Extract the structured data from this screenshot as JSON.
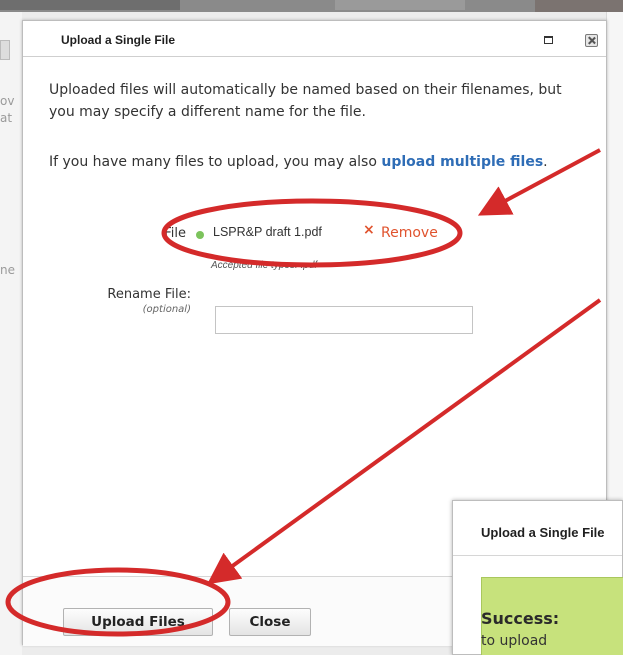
{
  "colors": {
    "link": "#2f6db6",
    "remove": "#e0532e",
    "file_status": "#7cc35c",
    "success_bg": "#c7e27c",
    "annotation": "#d42a2a"
  },
  "background": {
    "left_fragments": [
      "ov",
      "at",
      "ne"
    ]
  },
  "dialog": {
    "title": "Upload a Single File",
    "intro": "Uploaded files will automatically be named based on their filenames, but you may specify a different name for the file.",
    "multi_prefix": "If you have many files to upload, you may also ",
    "multi_link": "upload multiple files",
    "multi_suffix": ".",
    "file_label": "File",
    "file_name": "LSPR&P draft 1.pdf",
    "file_remove_x": "×",
    "file_remove": "Remove",
    "accepted_text": "Accepted file types: .pdf",
    "rename_label": "Rename File:",
    "rename_optional": "(optional)",
    "rename_value": "",
    "upload_button": "Upload Files",
    "close_button": "Close"
  },
  "second_dialog": {
    "title": "Upload a Single File",
    "success_label": "Success:",
    "success_text": "to upload"
  }
}
